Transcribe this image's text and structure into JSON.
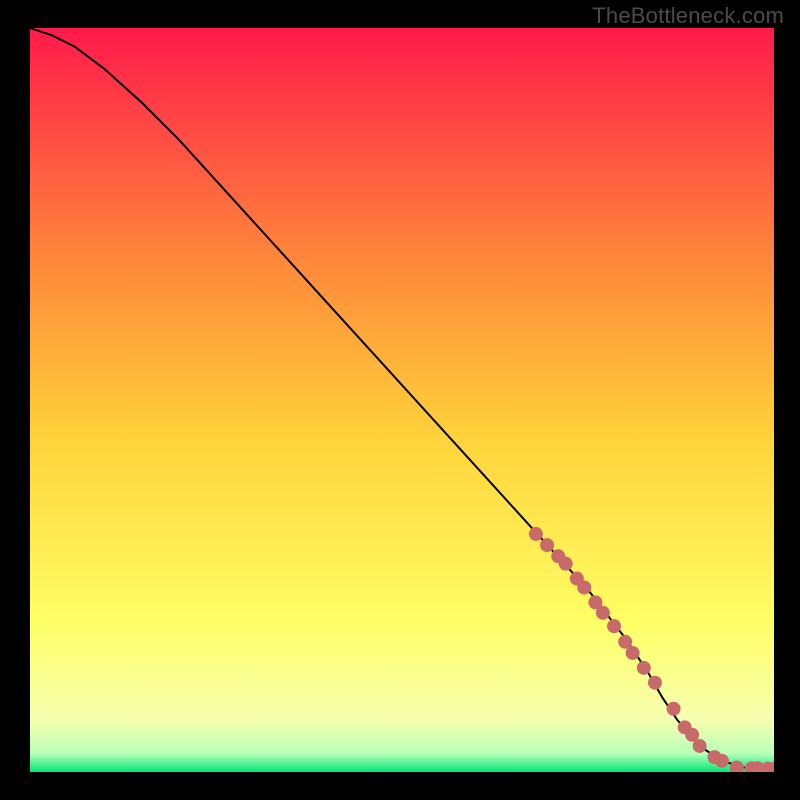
{
  "watermark": "TheBottleneck.com",
  "colors": {
    "gradient_top": "#ff1a4b",
    "gradient_mid_upper": "#ff8a3a",
    "gradient_mid": "#ffd23a",
    "gradient_mid_lower": "#ffff66",
    "gradient_pale": "#f6ffb0",
    "gradient_bottom": "#00e676",
    "curve": "#000000",
    "marker": "#c96a6a",
    "frame": "#000000"
  },
  "chart_data": {
    "type": "line",
    "title": "",
    "xlabel": "",
    "ylabel": "",
    "xlim": [
      0,
      100
    ],
    "ylim": [
      0,
      100
    ],
    "curve": {
      "x": [
        0,
        3,
        6,
        10,
        15,
        20,
        30,
        40,
        50,
        60,
        70,
        75,
        80,
        83,
        85,
        87,
        90,
        93,
        96,
        100
      ],
      "y": [
        100,
        99,
        97.5,
        94.5,
        90,
        85,
        74,
        63,
        52,
        41,
        30,
        24.5,
        18,
        13.5,
        10,
        7,
        3.5,
        1.5,
        0.6,
        0.4
      ]
    },
    "series": [
      {
        "name": "highlighted-points",
        "x": [
          68,
          69.5,
          71,
          72,
          73.5,
          74.5,
          76,
          77,
          78.5,
          80,
          81,
          82.5,
          84,
          86.5,
          88,
          89,
          90,
          92,
          93,
          95,
          97,
          97.8,
          99.2,
          100
        ],
        "y": [
          32,
          30.5,
          29,
          28,
          26,
          24.8,
          22.8,
          21.4,
          19.6,
          17.5,
          16,
          14,
          12,
          8.5,
          6,
          5,
          3.5,
          2,
          1.5,
          0.6,
          0.5,
          0.5,
          0.45,
          0.4
        ]
      }
    ]
  }
}
